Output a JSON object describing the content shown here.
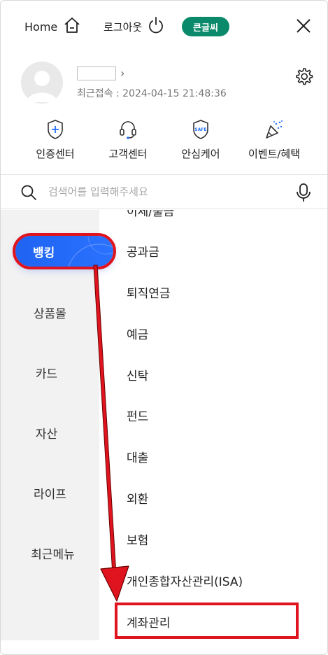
{
  "topbar": {
    "home_label": "Home",
    "logout_label": "로그아웃",
    "bigfont_label": "큰글씨"
  },
  "profile": {
    "chevron": "›",
    "last_login": "최근접속 : 2024-04-15 21:48:36"
  },
  "quick_menu": [
    {
      "label": "인증센터",
      "icon": "shield-plus-icon"
    },
    {
      "label": "고객센터",
      "icon": "headset-icon"
    },
    {
      "label": "안심케어",
      "icon": "safe-shield-icon",
      "badge": "SAFE"
    },
    {
      "label": "이벤트/혜택",
      "icon": "party-popper-icon"
    }
  ],
  "search": {
    "placeholder": "검색어를 입력해주세요"
  },
  "categories": {
    "active": "뱅킹",
    "items": [
      "상품몰",
      "카드",
      "자산",
      "라이프",
      "최근메뉴"
    ]
  },
  "submenu": {
    "cut_top": "이체/출금",
    "items": [
      "공과금",
      "퇴직연금",
      "예금",
      "신탁",
      "펀드",
      "대출",
      "외환",
      "보험",
      "개인종합자산관리(ISA)",
      "계좌관리"
    ]
  },
  "colors": {
    "accent_blue": "#1f63f2",
    "bigfont_green": "#0a8a6a",
    "annotation_red": "#e0141e"
  }
}
